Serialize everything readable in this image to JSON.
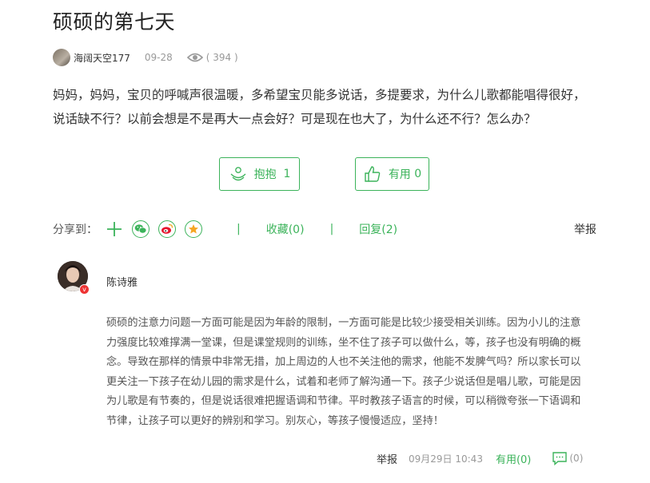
{
  "question": {
    "title": "硕硕的第七天",
    "author": "海阔天空177",
    "date": "09-28",
    "views": "( 394 )",
    "body": "妈妈，妈妈，宝贝的呼喊声很温暖，多希望宝贝能多说话，多提要求，为什么儿歌都能唱得很好，说话缺不行？以前会想是不是再大一点会好？可是现在也大了，为什么还不行？怎么办？"
  },
  "actions": {
    "hug_label": "抱抱",
    "hug_count": "1",
    "useful_label": "有用",
    "useful_count": "0"
  },
  "share": {
    "label": "分享到：",
    "icons": [
      "plus-icon",
      "wechat-icon",
      "weibo-icon",
      "star-icon"
    ],
    "collect": "收藏(0)",
    "reply": "回复(2)",
    "report": "举报",
    "separator": "|"
  },
  "answer": {
    "name": "陈诗雅",
    "badge": "v",
    "body": "硕硕的注意力问题一方面可能是因为年龄的限制，一方面可能是比较少接受相关训练。因为小儿的注意力强度比较难撑满一堂课，但是课堂规则的训练，坐不住了孩子可以做什么，等，孩子也没有明确的概念。导致在那样的情景中非常无措，加上周边的人也不关注他的需求，他能不发脾气吗？所以家长可以更关注一下孩子在幼儿园的需求是什么，试着和老师了解沟通一下。孩子少说话但是唱儿歌，可能是因为儿歌是有节奏的，但是说话很难把握语调和节律。平时教孩子语言的时候，可以稍微夸张一下语调和节律，让孩子可以更好的辨别和学习。别灰心，等孩子慢慢适应，坚持！",
    "report": "举报",
    "time": "09月29日 10:43",
    "useful": "有用(0)",
    "comments": "(0)"
  },
  "colors": {
    "accent": "#3bb35a",
    "weibo": "#e6162d",
    "star": "#f5a623"
  }
}
